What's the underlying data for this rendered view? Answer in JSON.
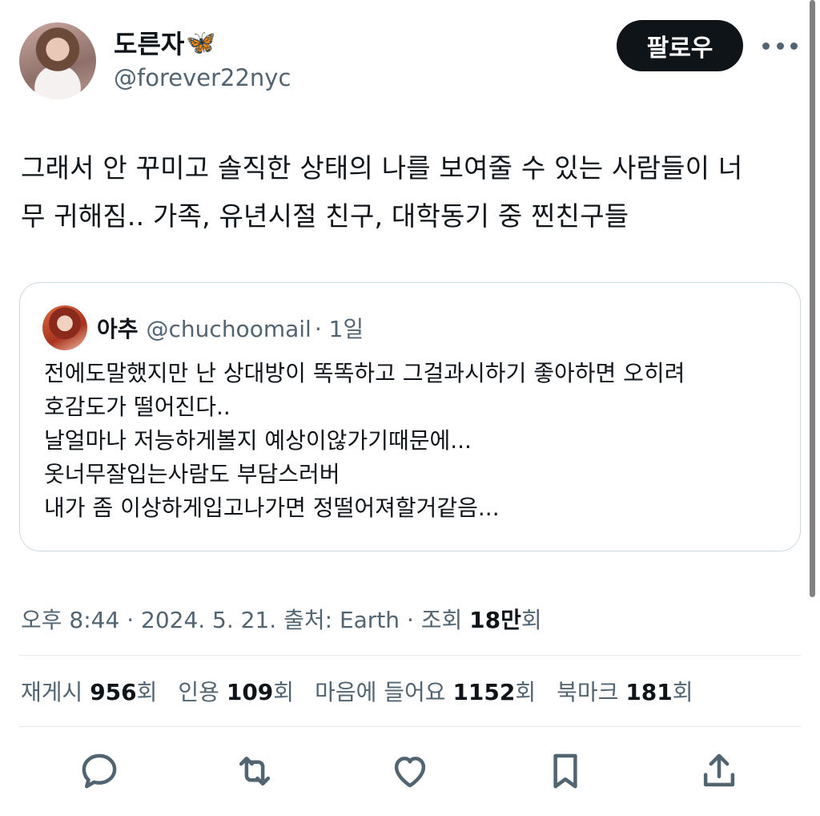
{
  "author": {
    "display_name": "도른자",
    "name_emoji": "🦋",
    "handle": "@forever22nyc"
  },
  "follow_label": "팔로우",
  "tweet_text_line1": "그래서 안 꾸미고 솔직한 상태의 나를 보여줄 수 있는 사람들이 너",
  "tweet_text_line2": "무 귀해짐.. 가족, 유년시절 친구, 대학동기 중 찐친구들",
  "quote": {
    "name": "아추",
    "handle": "@chuchoomail",
    "time": "· 1일",
    "lines": [
      "전에도말했지만  난 상대방이 똑똑하고 그걸과시하기 좋아하면 오히려",
      "호감도가 떨어진다..",
      "날얼마나 저능하게볼지 예상이않가기때문에...",
      "옷너무잘입는사람도 부담스러버",
      "내가 좀 이상하게입고나가면  정떨어져할거같음..."
    ]
  },
  "meta": {
    "prefix": "오후 8:44 · 2024. 5. 21. 출처: Earth · 조회 ",
    "views": "18만",
    "views_suffix": "회"
  },
  "stats": {
    "reposts_label": "재게시",
    "reposts": "956",
    "quotes_label": "인용",
    "quotes": "109",
    "likes_label": "마음에 들어요",
    "likes": "1152",
    "bookmarks_label": "북마크",
    "bookmarks": "181",
    "unit": "회"
  },
  "colors": {
    "text": "#0f1419",
    "secondary": "#536471",
    "border": "#cfd9de",
    "follow_bg": "#0f1419"
  },
  "icons": [
    "more-icon",
    "reply-icon",
    "repost-icon",
    "like-icon",
    "bookmark-icon",
    "share-icon"
  ]
}
